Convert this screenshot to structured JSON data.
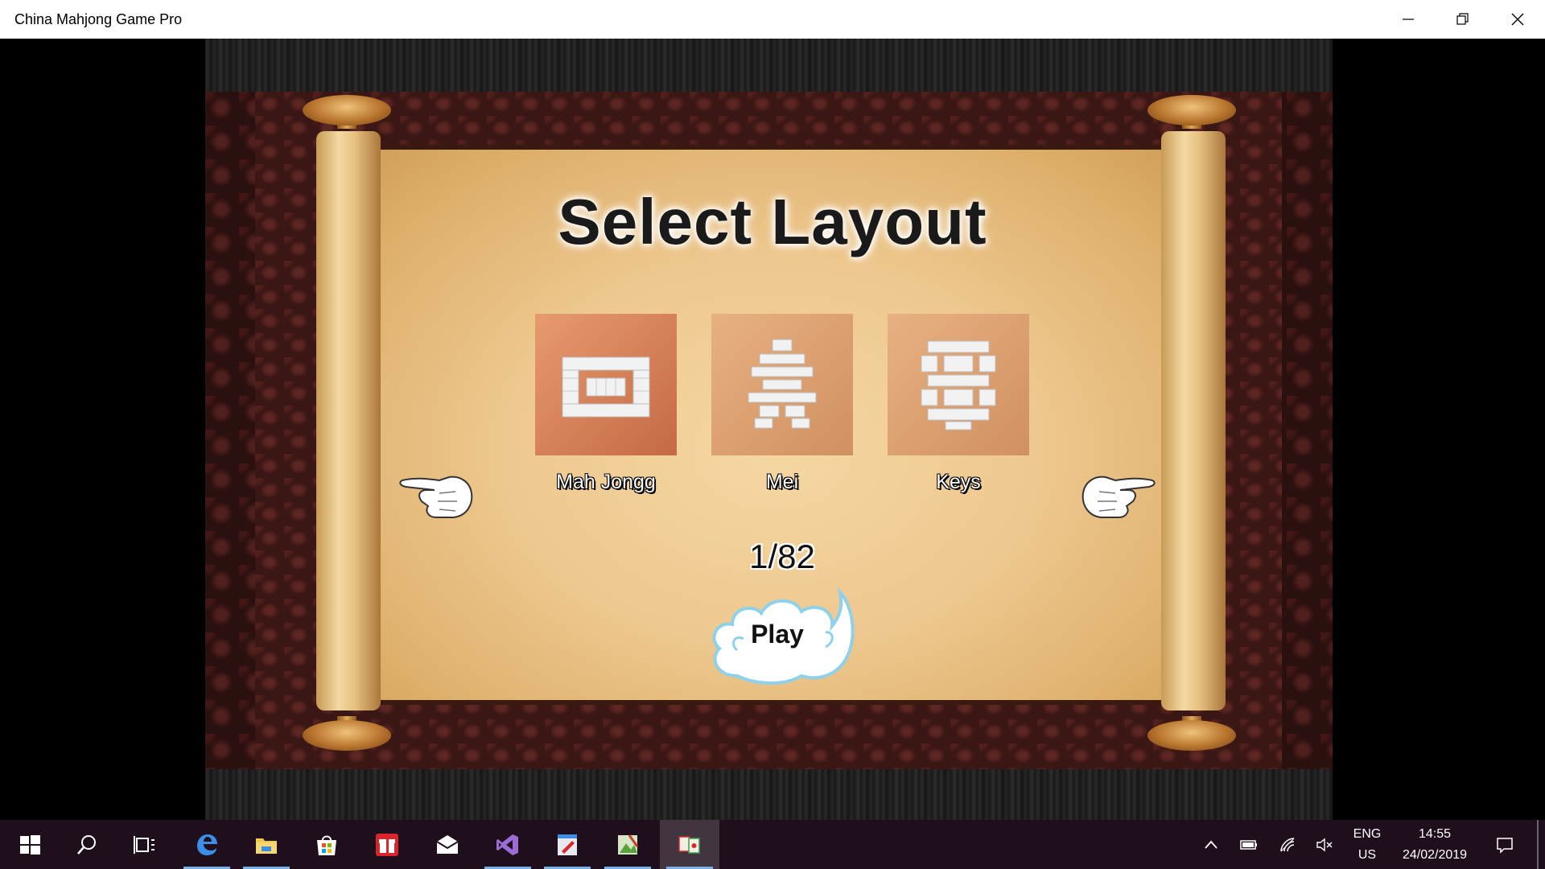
{
  "window": {
    "title": "China Mahjong Game Pro"
  },
  "screen": {
    "heading": "Select Layout",
    "layouts": [
      {
        "name": "Mah Jongg",
        "selected": true
      },
      {
        "name": "Mei",
        "selected": false
      },
      {
        "name": "Keys",
        "selected": false
      }
    ],
    "counter": "1/82",
    "play_label": "Play"
  },
  "taskbar": {
    "apps": [
      "start-icon",
      "search-icon",
      "task-view-icon",
      "edge-icon",
      "file-explorer-icon",
      "store-icon",
      "gift-app-icon",
      "mail-icon",
      "visual-studio-icon",
      "paint-app-icon",
      "game-app-icon",
      "mahjong-app-icon"
    ],
    "language": "ENG",
    "region": "US",
    "time": "14:55",
    "date": "24/02/2019"
  },
  "colors": {
    "selected_tile": "#c46a44",
    "tile": "#d1905f",
    "parchment": "#eec88f",
    "frame": "#2a100f",
    "taskbar": "#1f0f1c",
    "active_underline": "#7ab0e6"
  }
}
